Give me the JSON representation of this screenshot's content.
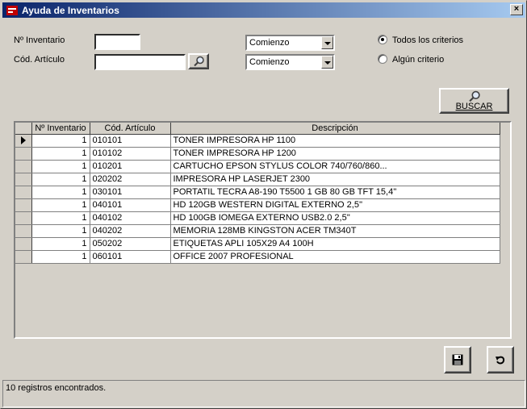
{
  "window": {
    "title": "Ayuda de Inventarios",
    "close": "×"
  },
  "filters": {
    "inventario_label": "Nº Inventario",
    "inventario_value": "",
    "articulo_label": "Cód. Artículo",
    "articulo_value": "",
    "combo1": "Comienzo",
    "combo2": "Comienzo",
    "radio_all": "Todos los criterios",
    "radio_any": "Algún criterio",
    "radio_selected": "all"
  },
  "search_button": {
    "label": "BUSCAR"
  },
  "table": {
    "columns": [
      "Nº Inventario",
      "Cód. Artículo",
      "Descripción"
    ],
    "rows": [
      [
        "1",
        "010101",
        "TONER IMPRESORA HP 1100"
      ],
      [
        "1",
        "010102",
        "TONER IMPRESORA HP 1200"
      ],
      [
        "1",
        "010201",
        "CARTUCHO EPSON STYLUS COLOR 740/760/860..."
      ],
      [
        "1",
        "020202",
        "IMPRESORA HP LASERJET 2300"
      ],
      [
        "1",
        "030101",
        "PORTATIL TECRA A8-190 T5500 1 GB 80 GB TFT 15,4''"
      ],
      [
        "1",
        "040101",
        "HD 120GB WESTERN DIGITAL EXTERNO 2,5''"
      ],
      [
        "1",
        "040102",
        "HD 100GB IOMEGA EXTERNO USB2.0 2,5''"
      ],
      [
        "1",
        "040202",
        "MEMORIA 128MB KINGSTON ACER TM340T"
      ],
      [
        "1",
        "050202",
        "ETIQUETAS APLI 105X29 A4 100H"
      ],
      [
        "1",
        "060101",
        "OFFICE 2007 PROFESIONAL"
      ]
    ]
  },
  "status": {
    "text": "10 registros encontrados."
  },
  "icons": {
    "app": "app-icon",
    "lookup": "magnifier-icon",
    "search": "magnifier-icon",
    "save": "floppy-disk-icon",
    "undo": "undo-arrow-icon"
  }
}
